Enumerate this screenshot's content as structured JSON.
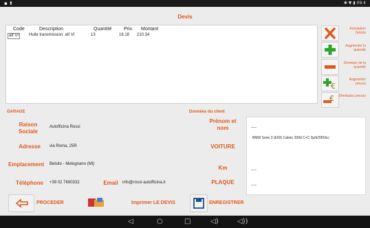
{
  "status": {
    "left_icons": "▪ ⬆",
    "right": "✱ ▼ ▮ 09:4"
  },
  "title": "Devis",
  "table": {
    "headers": [
      "Code",
      "Description",
      "Quantité",
      "Prix",
      "Montant"
    ],
    "rows": [
      [
        "atf VI",
        "Huile transmission: atf VI",
        "13",
        "16.18",
        "210.34"
      ]
    ]
  },
  "side_actions": [
    {
      "icon": "close-icon",
      "label": "Annulation l'article"
    },
    {
      "icon": "plus-icon",
      "label": "Augmenter la quantité"
    },
    {
      "icon": "minus-icon",
      "label": "Diminuer de la quantité"
    },
    {
      "icon": "euro-plus-icon",
      "label": "Augmenter prezzo"
    },
    {
      "icon": "euro-minus-icon",
      "label": "Diminuisci prezzo"
    }
  ],
  "garage": {
    "section": "GARAGE",
    "raison_label": "Raison Sociale",
    "raison_value": "Autofficina Rossi",
    "adresse_label": "Adresse",
    "adresse_value": "via Roma, 25R",
    "emplacement_label": "Emplacement",
    "emplacement_value": "Belsito - Melognano (MI)",
    "telephone_label": "Téléphone",
    "telephone_value": "+39 02 7690332",
    "email_label": "Email",
    "email_value": "info@rossi-autofficina.it"
  },
  "client": {
    "section": "Données du client",
    "prenom_label": "Prénom et nom",
    "prenom_value": "",
    "voiture_label": "VOITURE",
    "voiture_value": "BMW Serie 3 (E93) Cabrio 330d C+C 2p/b/2993cc",
    "km_label": "Km",
    "km_value": "",
    "plaque_label": "PLAQUE",
    "plaque_value": ""
  },
  "bottom": {
    "proceder": "PROCEDER",
    "imprimer": "Imprimer LE DEVIS",
    "enregistrer": "ENREGISTRER"
  },
  "nav": {
    "back": "◁",
    "home": "○",
    "recents": "□",
    "vol_down": "◁)",
    "vol_up": "◁))"
  },
  "colors": {
    "accent": "#e05a1a",
    "green": "#2aa52a",
    "red": "#e05a1a"
  }
}
